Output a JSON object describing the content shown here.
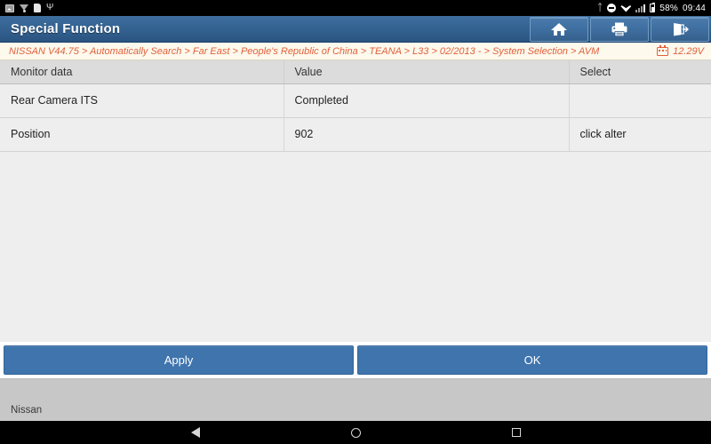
{
  "statusbar": {
    "left_icons": [
      "screenshot-icon",
      "download-icon",
      "document-icon",
      "usb-icon"
    ],
    "right_icons": [
      "bluetooth-icon",
      "do-not-disturb-icon",
      "wifi-icon",
      "signal-icon",
      "battery-icon"
    ],
    "battery_percent": "58%",
    "time": "09:44"
  },
  "titlebar": {
    "title": "Special Function",
    "actions": [
      {
        "name": "home-button",
        "icon": "home-icon"
      },
      {
        "name": "print-button",
        "icon": "printer-icon"
      },
      {
        "name": "exit-button",
        "icon": "exit-icon"
      }
    ]
  },
  "breadcrumb": {
    "path": "NISSAN V44.75 > Automatically Search > Far East > People's Republic of China > TEANA > L33 > 02/2013 - > System Selection > AVM",
    "voltage": "12.29V",
    "voltage_icon": "car-battery-icon"
  },
  "table": {
    "columns": [
      "Monitor data",
      "Value",
      "Select"
    ],
    "rows": [
      {
        "monitor_data": "Rear Camera ITS",
        "value": "Completed",
        "select": ""
      },
      {
        "monitor_data": "Position",
        "value": "902",
        "select": "click alter"
      }
    ]
  },
  "buttons": {
    "apply": "Apply",
    "ok": "OK"
  },
  "footer": {
    "label": "Nissan"
  },
  "navbar": {
    "back": "back-icon",
    "home": "home-circle-icon",
    "recents": "recents-square-icon"
  },
  "colors": {
    "titlebar_blue": "#33618f",
    "action_button_blue": "#3f74ad",
    "breadcrumb_text": "#e0603c",
    "breadcrumb_bg": "#fdf9ec",
    "content_bg": "#eeeeee",
    "header_bg": "#dcdcdc",
    "footer_bg": "#c7c7c7"
  }
}
